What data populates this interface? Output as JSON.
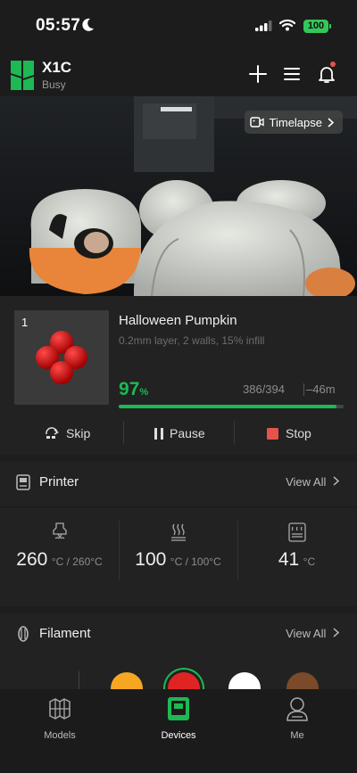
{
  "status_bar": {
    "time": "05:57",
    "battery": "100"
  },
  "header": {
    "device_name": "X1C",
    "device_status": "Busy"
  },
  "camera": {
    "timelapse_label": "Timelapse"
  },
  "job": {
    "plate_number": "1",
    "title": "Halloween Pumpkin",
    "subtitle": "0.2mm layer, 2 walls, 15% infill",
    "progress_value": "97",
    "progress_symbol": "%",
    "progress_fraction": 0.97,
    "layers": "386/394",
    "remaining": "–46m",
    "controls": {
      "skip": "Skip",
      "pause": "Pause",
      "stop": "Stop"
    }
  },
  "printer": {
    "title": "Printer",
    "view_all": "View All",
    "temps": [
      {
        "icon": "nozzle-icon",
        "value": "260",
        "unit": "°C / 260°C"
      },
      {
        "icon": "heatbed-icon",
        "value": "100",
        "unit": "°C / 100°C"
      },
      {
        "icon": "chamber-icon",
        "value": "41",
        "unit": "°C"
      }
    ]
  },
  "filament": {
    "title": "Filament",
    "view_all": "View All",
    "colors": [
      "#f5a623",
      "#e02424",
      "#ffffff",
      "#7a4a2a"
    ]
  },
  "tabs": [
    {
      "label": "Models",
      "icon": "models-icon",
      "active": false
    },
    {
      "label": "Devices",
      "icon": "devices-icon",
      "active": true
    },
    {
      "label": "Me",
      "icon": "profile-icon",
      "active": false
    }
  ],
  "colors": {
    "accent": "#1db954",
    "stop_red": "#e5534b"
  }
}
